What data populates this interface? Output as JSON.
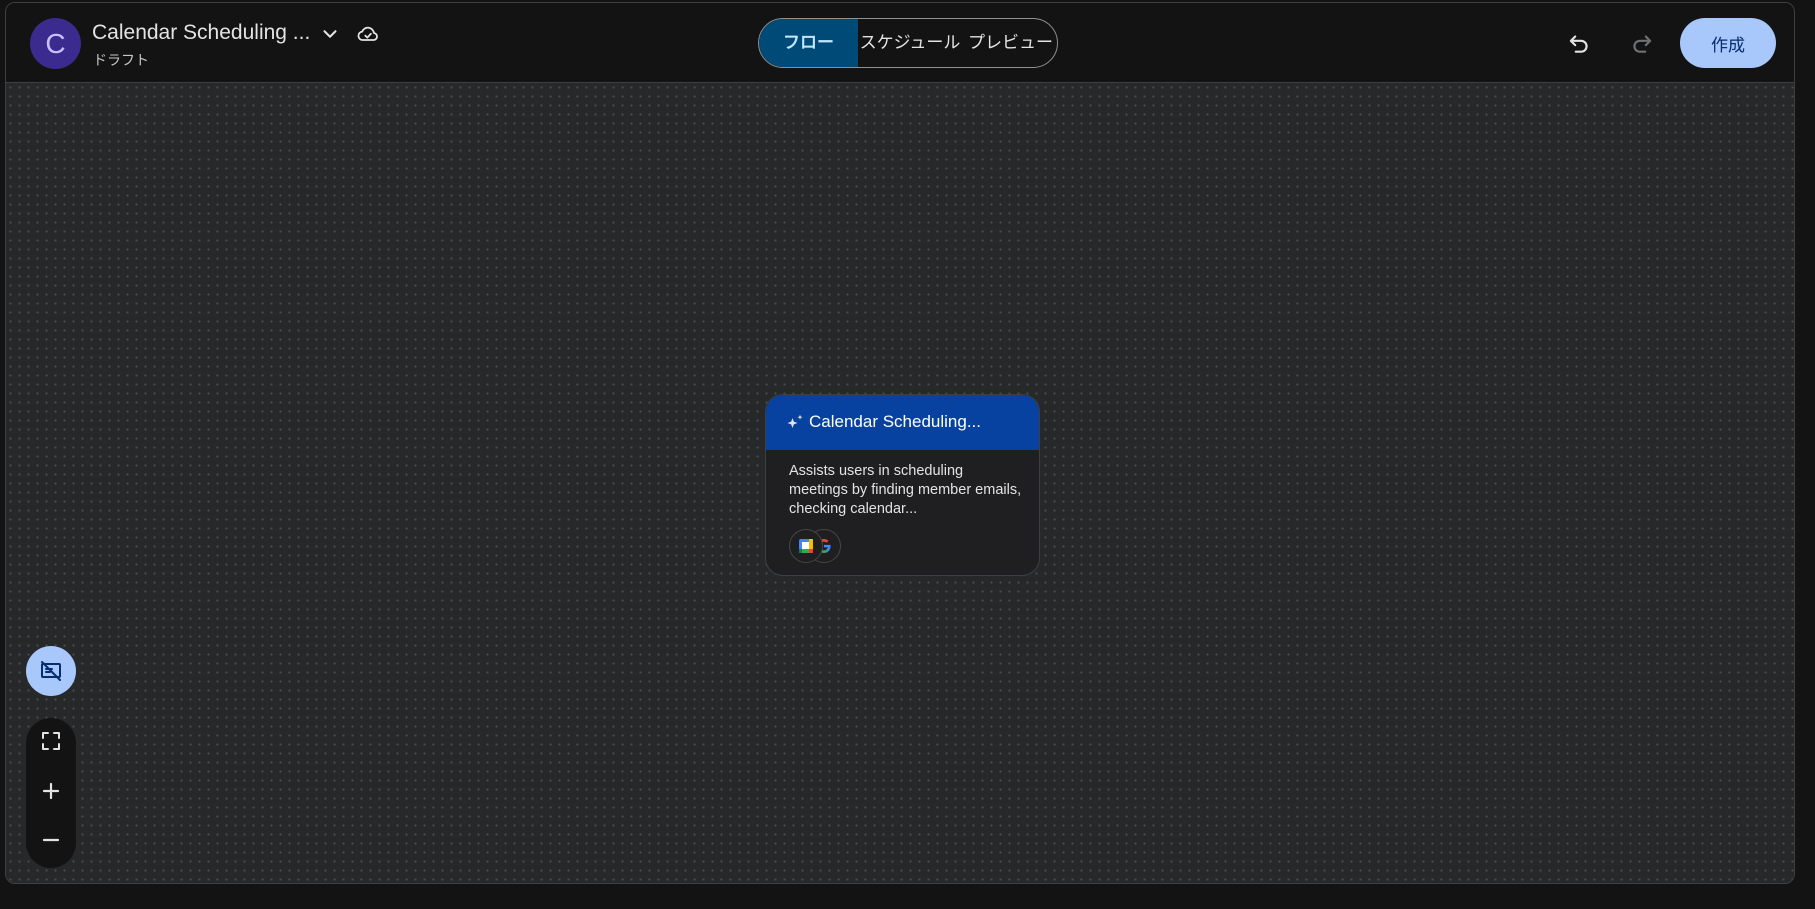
{
  "header": {
    "avatar_letter": "C",
    "title": "Calendar Scheduling ...",
    "subtitle": "ドラフト",
    "tabs": [
      {
        "label": "フロー",
        "active": true
      },
      {
        "label": "スケジュール",
        "active": false
      },
      {
        "label": "プレビュー",
        "active": false
      }
    ],
    "create_label": "作成",
    "icons": {
      "title_dropdown": "chevron-down-icon",
      "save_status": "cloud-done-icon",
      "undo": "undo-icon",
      "redo": "redo-icon"
    }
  },
  "canvas": {
    "node": {
      "title": "Calendar Scheduling...",
      "description": "Assists users in scheduling meetings by finding member emails, checking calendar...",
      "tools": [
        "google-calendar-icon",
        "google-icon"
      ]
    },
    "controls": {
      "minimap_toggle": "minimap-off-icon",
      "fit_view": "fit-screen-icon",
      "zoom_in": "plus-icon",
      "zoom_out": "minus-icon"
    }
  },
  "colors": {
    "accent": "#a8c7fa",
    "active_tab": "#004a77",
    "node_header": "#0842a0",
    "background": "#131314"
  }
}
